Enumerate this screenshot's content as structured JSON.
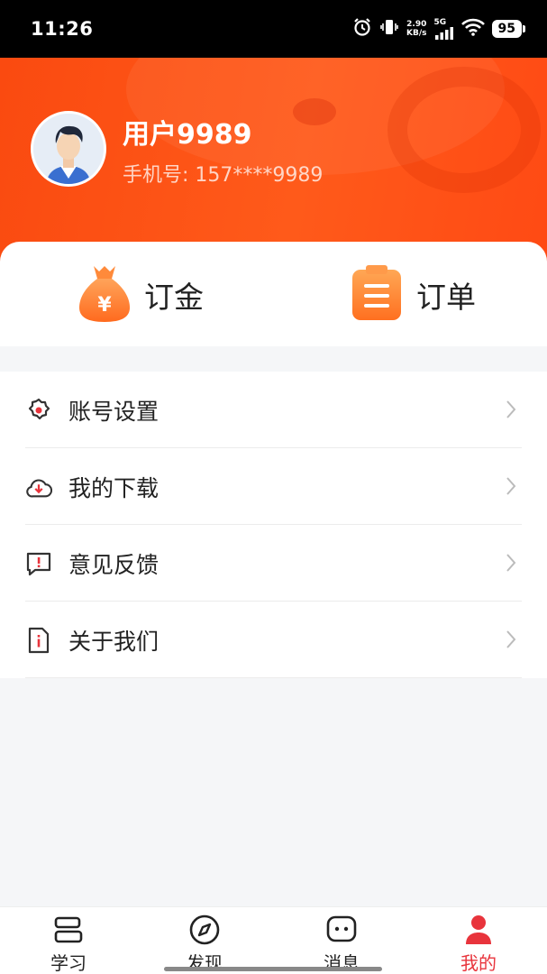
{
  "status_bar": {
    "time": "11:26",
    "speed_value": "2.90",
    "speed_unit": "KB/s",
    "network": "5G",
    "battery": "95"
  },
  "profile": {
    "username": "用户9989",
    "phone": "手机号: 157****9989",
    "avatar_icon": "user-avatar-icon"
  },
  "quick_actions": [
    {
      "label": "订金",
      "icon": "money-bag-icon",
      "color": "#ff7a2a"
    },
    {
      "label": "订单",
      "icon": "clipboard-icon",
      "color": "#ff7a2a"
    }
  ],
  "menu": [
    {
      "label": "账号设置",
      "icon": "gear-icon"
    },
    {
      "label": "我的下载",
      "icon": "cloud-download-icon"
    },
    {
      "label": "意见反馈",
      "icon": "feedback-icon"
    },
    {
      "label": "关于我们",
      "icon": "info-doc-icon"
    }
  ],
  "tabs": [
    {
      "label": "学习",
      "icon": "books-icon",
      "active": false
    },
    {
      "label": "发现",
      "icon": "compass-icon",
      "active": false
    },
    {
      "label": "消息",
      "icon": "message-icon",
      "active": false
    },
    {
      "label": "我的",
      "icon": "person-icon",
      "active": true
    }
  ],
  "colors": {
    "header": "#fa4a10",
    "accent": "#e8343c",
    "background": "#f5f6f8"
  }
}
